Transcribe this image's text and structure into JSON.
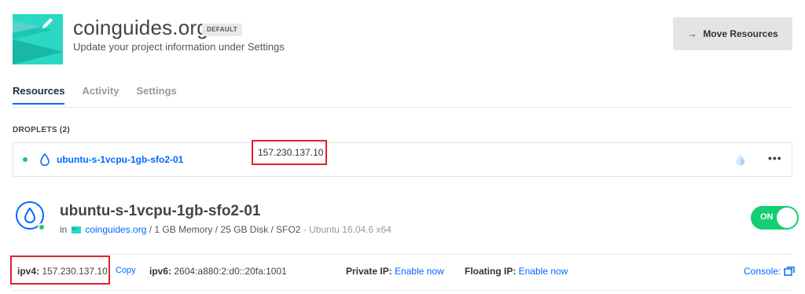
{
  "project": {
    "title": "coinguides.org",
    "badge": "DEFAULT",
    "subtitle": "Update your project information under Settings",
    "move_button": "Move Resources",
    "logo_icon": "project-logo-icon"
  },
  "tabs": [
    {
      "label": "Resources",
      "active": true
    },
    {
      "label": "Activity",
      "active": false
    },
    {
      "label": "Settings",
      "active": false
    }
  ],
  "droplets_section": {
    "title": "DROPLETS (2)",
    "rows": [
      {
        "name": "ubuntu-s-1vcpu-1gb-sfo2-01",
        "ip": "157.230.137.10",
        "status": "active"
      }
    ]
  },
  "droplet_detail": {
    "name": "ubuntu-s-1vcpu-1gb-sfo2-01",
    "in_label": "in",
    "project_link": "coinguides.org",
    "specs": "/ 1 GB Memory / 25 GB Disk / SFO2",
    "os": "- Ubuntu 16.04.6 x64",
    "power_label": "ON"
  },
  "network": {
    "ipv4_label": "ipv4:",
    "ipv4_value": "157.230.137.10",
    "copy_label": "Copy",
    "ipv6_label": "ipv6:",
    "ipv6_value": "2604:a880:2:d0::20fa:1001",
    "private_ip_label": "Private IP:",
    "private_ip_action": "Enable now",
    "floating_ip_label": "Floating IP:",
    "floating_ip_action": "Enable now",
    "console_label": "Console:"
  },
  "colors": {
    "accent": "#0069ff",
    "success": "#15cd72",
    "highlight": "#e0202d",
    "logo_teal": "#2bd8c4"
  }
}
